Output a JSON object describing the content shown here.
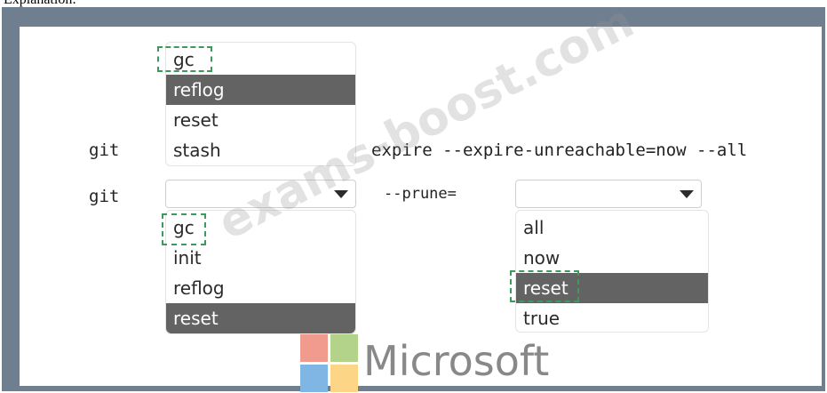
{
  "header": {
    "text": "Explanation:"
  },
  "colors": {
    "frame": "#6f7f8f",
    "selected": "#636363",
    "dashed": "#3d9a5c"
  },
  "row1": {
    "prefix": "git",
    "options": [
      "gc",
      "reflog",
      "reset",
      "stash"
    ],
    "selected": "reflog",
    "suffix": "expire --expire-unreachable=now --all"
  },
  "row2": {
    "prefix": "git",
    "dropdown1": {
      "value": "",
      "options": [
        "gc",
        "init",
        "reflog",
        "reset"
      ],
      "selected": "reset"
    },
    "middle": "--prune=",
    "dropdown2": {
      "value": "",
      "options": [
        "all",
        "now",
        "reset",
        "true"
      ],
      "selected": "reset"
    }
  },
  "watermark": "exams-boost.com",
  "logo": {
    "text": "Microsoft"
  }
}
